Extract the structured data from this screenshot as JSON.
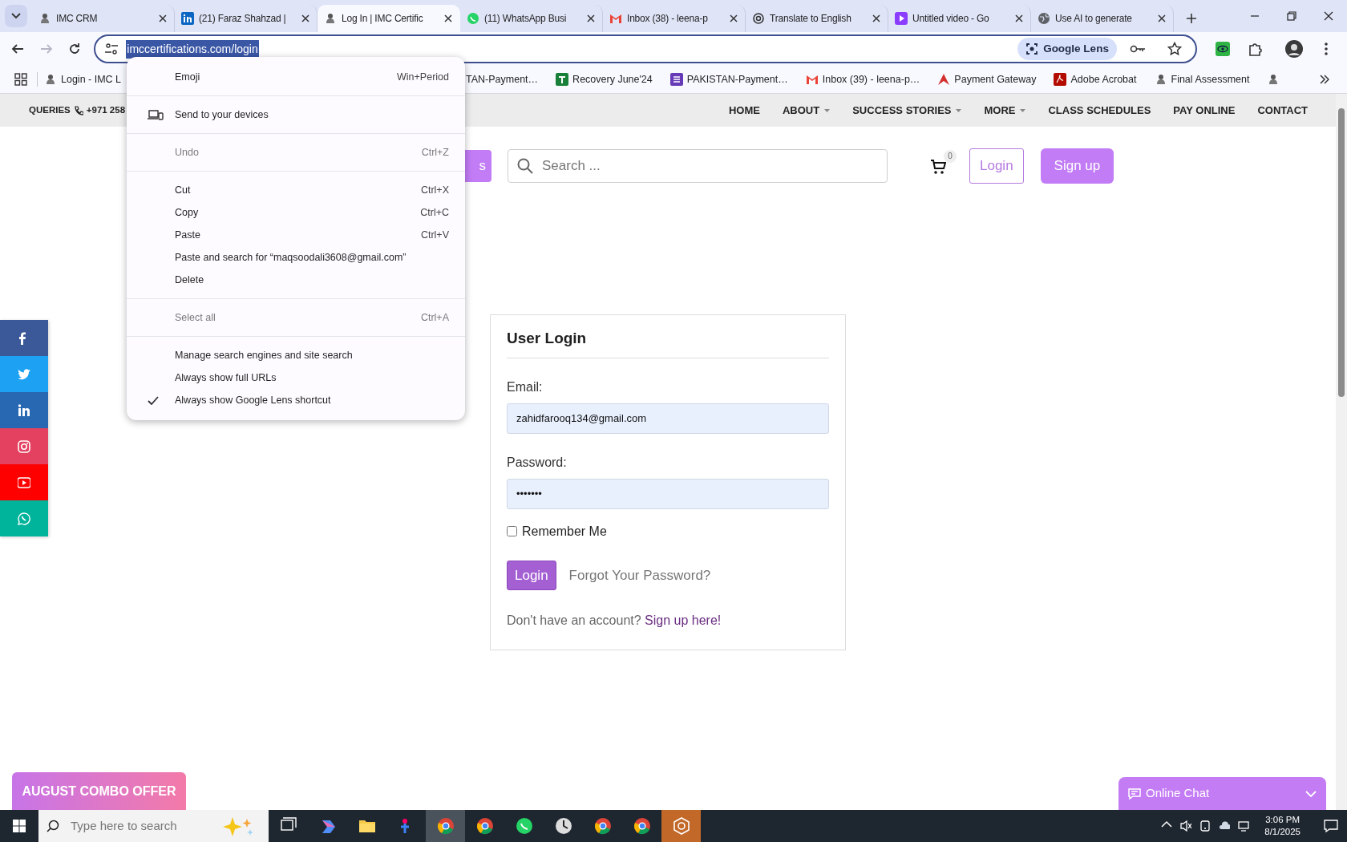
{
  "browser": {
    "tabs": [
      {
        "title": "IMC CRM",
        "selected": false
      },
      {
        "title": "(21) Faraz Shahzad |",
        "selected": false
      },
      {
        "title": "Log In | IMC Certific",
        "selected": true
      },
      {
        "title": "(11) WhatsApp Busi",
        "selected": false
      },
      {
        "title": "Inbox (38) - leena-p",
        "selected": false
      },
      {
        "title": "Translate to English",
        "selected": false
      },
      {
        "title": "Untitled video - Go",
        "selected": false
      },
      {
        "title": "Use AI to generate",
        "selected": false
      }
    ],
    "nav_buttons": [
      {
        "kind": "back",
        "disabled": false
      },
      {
        "kind": "forward",
        "disabled": true
      },
      {
        "kind": "reload",
        "disabled": false
      }
    ],
    "address": {
      "url": "imccertifications.com/login",
      "url_selected": true,
      "lens_chip": "Google Lens"
    },
    "bookmarks": [
      {
        "label": "Login - IMC L"
      },
      {
        "label": "TAN-Payment…"
      },
      {
        "label": "Recovery June'24"
      },
      {
        "label": "PAKISTAN-Payment…"
      },
      {
        "label": "Inbox (39) - leena-p…"
      },
      {
        "label": "Payment Gateway"
      },
      {
        "label": "Adobe Acrobat"
      },
      {
        "label": "Final Assessment"
      }
    ]
  },
  "context_menu": {
    "groups": [
      [
        {
          "label": "Emoji",
          "shortcut": "Win+Period",
          "kind": "plain",
          "disabled": false,
          "checked": false
        }
      ],
      [
        {
          "label": "Send to your devices",
          "kind": "devices",
          "disabled": false,
          "checked": false
        }
      ],
      [
        {
          "label": "Undo",
          "shortcut": "Ctrl+Z",
          "kind": "plain",
          "disabled": true,
          "checked": false
        }
      ],
      [
        {
          "label": "Cut",
          "shortcut": "Ctrl+X",
          "kind": "plain",
          "disabled": false,
          "checked": false
        },
        {
          "label": "Copy",
          "shortcut": "Ctrl+C",
          "kind": "plain",
          "disabled": false,
          "checked": false
        },
        {
          "label": "Paste",
          "shortcut": "Ctrl+V",
          "kind": "plain",
          "disabled": false,
          "checked": false
        },
        {
          "label": "Paste and search for “maqsoodali3608@gmail.com”",
          "kind": "plain",
          "disabled": false,
          "checked": false
        },
        {
          "label": "Delete",
          "kind": "plain",
          "disabled": false,
          "checked": false
        }
      ],
      [
        {
          "label": "Select all",
          "shortcut": "Ctrl+A",
          "kind": "plain",
          "disabled": true,
          "checked": false
        }
      ],
      [
        {
          "label": "Manage search engines and site search",
          "kind": "plain",
          "disabled": false,
          "checked": false
        },
        {
          "label": "Always show full URLs",
          "kind": "plain",
          "disabled": false,
          "checked": false
        },
        {
          "label": "Always show Google Lens shortcut",
          "kind": "plain",
          "disabled": false,
          "checked": true
        }
      ]
    ]
  },
  "site": {
    "topbar": {
      "queries": "QUERIES",
      "phone": "+971 258",
      "nav": [
        {
          "label": "HOME",
          "dropdown": false
        },
        {
          "label": "ABOUT",
          "dropdown": true
        },
        {
          "label": "SUCCESS STORIES",
          "dropdown": true
        },
        {
          "label": "MORE",
          "dropdown": true
        },
        {
          "label": "CLASS SCHEDULES",
          "dropdown": false
        },
        {
          "label": "PAY ONLINE",
          "dropdown": false
        },
        {
          "label": "CONTACT",
          "dropdown": false
        }
      ]
    },
    "header": {
      "partial_button": "s",
      "search_placeholder": "Search ...",
      "cart_count": "0",
      "login": "Login",
      "signup": "Sign up"
    },
    "login_card": {
      "title": "User Login",
      "email_label": "Email:",
      "email_value": "zahidfarooq134@gmail.com",
      "password_label": "Password:",
      "password_value": "•••••••",
      "remember_label": "Remember Me",
      "remember_checked": false,
      "submit": "Login",
      "forgot": "Forgot Your Password?",
      "signup_prompt": "Don't have an account?",
      "signup_link": "Sign up here!"
    },
    "social": [
      {
        "color": "#3b5998"
      },
      {
        "color": "#1da1f2"
      },
      {
        "color": "#2867b2"
      },
      {
        "color": "#e4405f"
      },
      {
        "color": "#ff0000"
      },
      {
        "color": "#00b39b"
      }
    ],
    "promo": "AUGUST COMBO OFFER",
    "chat": "Online Chat"
  },
  "taskbar": {
    "search_placeholder": "Type here to search",
    "time": "3:06 PM",
    "date": "8/1/2025",
    "apps": [
      {
        "active": false
      },
      {
        "active": false
      },
      {
        "active": false
      },
      {
        "active": false
      },
      {
        "active": true
      },
      {
        "active": false
      },
      {
        "active": false
      },
      {
        "active": false
      },
      {
        "active": false
      },
      {
        "active": false
      },
      {
        "active": true
      }
    ]
  }
}
